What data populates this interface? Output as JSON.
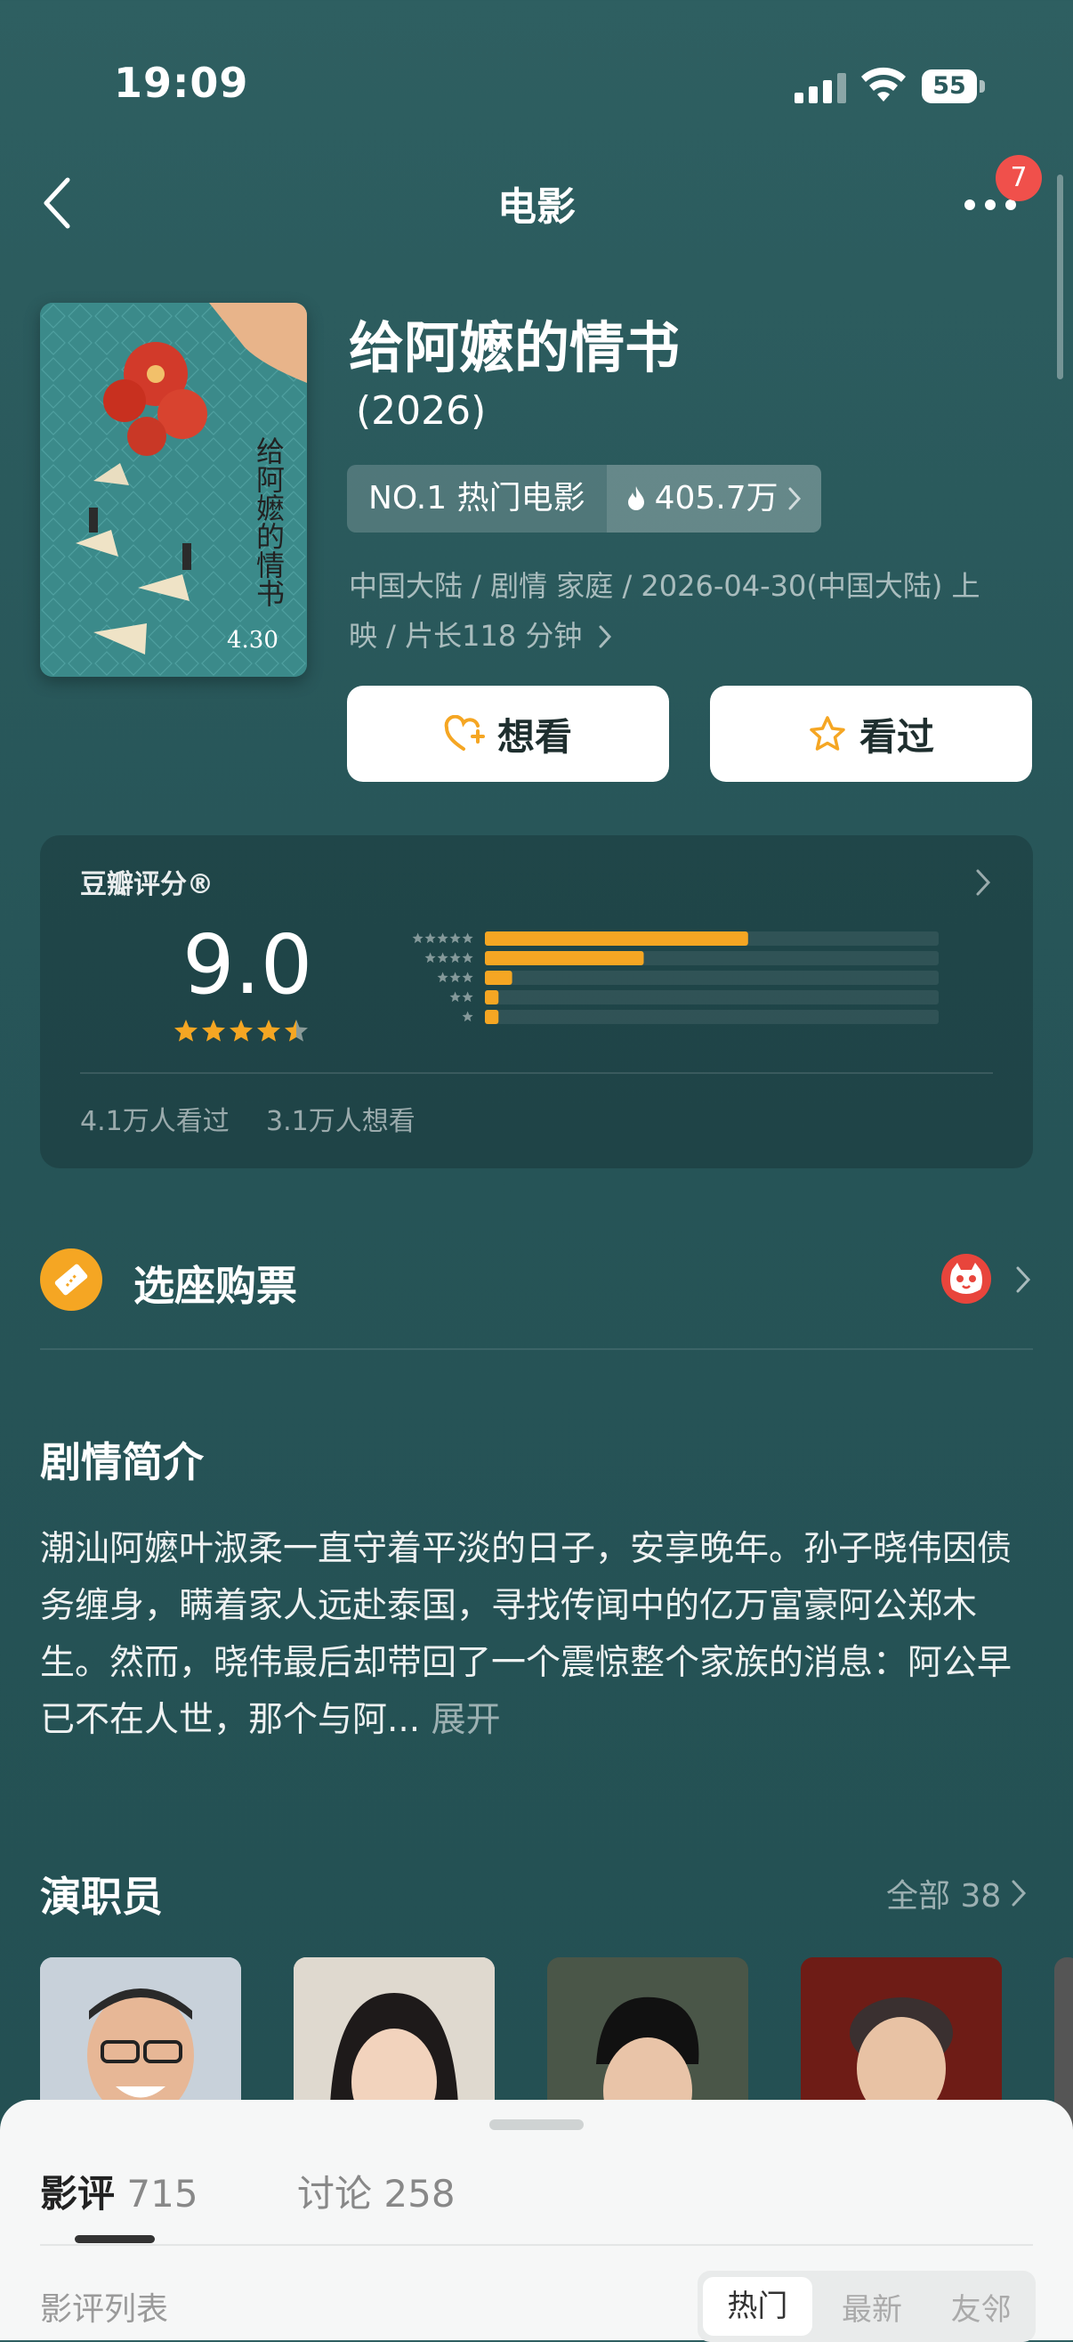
{
  "status_bar": {
    "time": "19:09",
    "battery": "55"
  },
  "nav": {
    "title": "电影",
    "badge_count": "7"
  },
  "movie": {
    "title": "给阿嬷的情书",
    "year": "(2026)",
    "rank_label": "NO.1 热门电影",
    "heat": "405.7万",
    "meta": "中国大陆 / 剧情 家庭 / 2026-04-30(中国大陆) 上映 / 片长118 分钟",
    "poster_title": "给阿嬷的情书",
    "poster_date": "4.30"
  },
  "actions": {
    "want_label": "想看",
    "seen_label": "看过"
  },
  "rating": {
    "title": "豆瓣评分®",
    "score": "9.0",
    "stars": 4.5,
    "distribution": [
      0.58,
      0.35,
      0.06,
      0.03,
      0.03
    ],
    "seen_count": "4.1万人看过",
    "want_count": "3.1万人想看"
  },
  "tickets": {
    "label": "选座购票"
  },
  "synopsis": {
    "heading": "剧情简介",
    "text": "潮汕阿嬷叶淑柔一直守着平淡的日子，安享晚年。孙子晓伟因债务缠身，瞒着家人远赴泰国，寻找传闻中的亿万富豪阿公郑木生。然而，晓伟最后却带回了一个震惊整个家族的消息：阿公早已不在人世，那个与阿...",
    "expand_label": "展开"
  },
  "cast": {
    "heading": "演职员",
    "all_label": "全部 38"
  },
  "sheet": {
    "tabs": [
      {
        "label": "影评",
        "count": "715"
      },
      {
        "label": "讨论",
        "count": "258"
      }
    ],
    "list_label": "影评列表",
    "sort_options": [
      "热门",
      "最新",
      "友邻"
    ]
  },
  "colors": {
    "accent": "#f5a623",
    "badge": "#f0504b",
    "background": "#2a5a5c"
  }
}
